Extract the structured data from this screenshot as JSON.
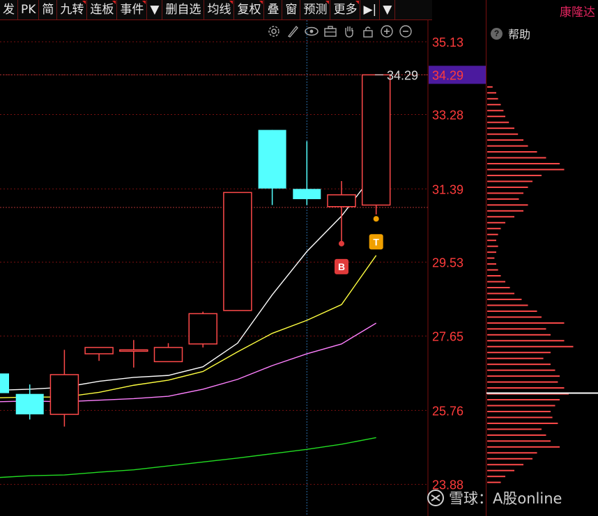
{
  "toolbar": {
    "items": [
      {
        "label": "发",
        "dot": false
      },
      {
        "label": "PK",
        "dot": false
      },
      {
        "label": "简",
        "dot": false
      },
      {
        "label": "九转",
        "dot": true
      },
      {
        "label": "连板",
        "dot": true
      },
      {
        "label": "事件",
        "dot": true
      },
      {
        "label": "▼",
        "dot": false
      },
      {
        "label": "删自选",
        "dot": false
      },
      {
        "label": "均线",
        "dot": true
      },
      {
        "label": "复权",
        "dot": true
      },
      {
        "label": "叠",
        "dot": false
      },
      {
        "label": "窗",
        "dot": false
      },
      {
        "label": "预测",
        "dot": true
      },
      {
        "label": "更多",
        "dot": true
      },
      {
        "label": "▶|",
        "dot": false
      },
      {
        "label": "▼",
        "dot": false
      }
    ]
  },
  "stock_name": "康隆达",
  "help": {
    "icon": "question-icon",
    "label": "帮助"
  },
  "chart_icons": [
    "gear-icon",
    "pen-icon",
    "eye-icon",
    "briefcase-icon",
    "hand-icon",
    "lock-icon",
    "zoom-in-icon",
    "zoom-out-icon"
  ],
  "watermark": "雪球：A股online",
  "colors": {
    "up": "#ff4a4a",
    "down": "#54ffff",
    "ma_white": "#ffffff",
    "ma_yellow": "#ffff40",
    "ma_pink": "#ff80ff",
    "ma_green": "#22dd22",
    "price_box": "#4b1a9e",
    "price_text": "#ff3b3b",
    "marker_b": "#e03a3a",
    "marker_t": "#f0a000"
  },
  "chart_data": {
    "type": "candlestick",
    "y_axis": {
      "ticks": [
        35.13,
        34.29,
        33.28,
        31.39,
        29.53,
        27.65,
        25.76,
        23.88
      ],
      "range": [
        23.58,
        35.86
      ]
    },
    "current_price": 34.29,
    "current_price_label": "34.29",
    "reference_line": 30.92,
    "grid": true,
    "candles": [
      {
        "open": 26.7,
        "high": 26.7,
        "low": 26.2,
        "close": 26.2
      },
      {
        "open": 26.18,
        "high": 26.42,
        "low": 25.53,
        "close": 25.66
      },
      {
        "open": 25.66,
        "high": 27.3,
        "low": 25.35,
        "close": 26.67
      },
      {
        "open": 27.2,
        "high": 27.36,
        "low": 27.02,
        "close": 27.36
      },
      {
        "open": 27.3,
        "high": 27.55,
        "low": 26.85,
        "close": 27.3
      },
      {
        "open": 27.0,
        "high": 27.47,
        "low": 27.0,
        "close": 27.36
      },
      {
        "open": 27.45,
        "high": 28.27,
        "low": 27.36,
        "close": 28.22
      },
      {
        "open": 28.3,
        "high": 31.3,
        "low": 28.3,
        "close": 31.3
      },
      {
        "open": 32.89,
        "high": 32.89,
        "low": 30.98,
        "close": 31.4
      },
      {
        "open": 31.39,
        "high": 32.6,
        "low": 30.98,
        "close": 31.13
      },
      {
        "open": 30.94,
        "high": 31.59,
        "low": 30.0,
        "close": 31.24
      },
      {
        "open": 30.98,
        "high": 34.29,
        "low": 30.74,
        "close": 34.29
      }
    ],
    "ma_white": [
      26.27,
      26.3,
      26.35,
      26.5,
      26.6,
      26.65,
      26.87,
      27.47,
      28.7,
      29.8,
      30.7,
      31.85
    ],
    "ma_yellow": [
      26.08,
      26.1,
      26.1,
      26.22,
      26.4,
      26.53,
      26.75,
      27.25,
      27.72,
      28.05,
      28.45,
      29.7
    ],
    "ma_pink": [
      25.98,
      26.0,
      25.98,
      26.02,
      26.06,
      26.12,
      26.3,
      26.55,
      26.9,
      27.2,
      27.45,
      27.98
    ],
    "ma_green": [
      24.05,
      24.1,
      24.12,
      24.19,
      24.25,
      24.35,
      24.45,
      24.55,
      24.66,
      24.77,
      24.9,
      25.07
    ],
    "signals": [
      {
        "label": "B",
        "index": 10,
        "value": 30.0
      },
      {
        "label": "T",
        "index": 11,
        "value": 30.63
      }
    ],
    "volume_profile": {
      "levels": [
        34.0,
        33.85,
        33.7,
        33.55,
        33.4,
        33.25,
        33.1,
        32.95,
        32.8,
        32.65,
        32.5,
        32.35,
        32.2,
        32.05,
        31.9,
        31.75,
        31.6,
        31.45,
        31.3,
        31.15,
        31.0,
        30.85,
        30.7,
        30.55,
        30.4,
        30.25,
        30.1,
        29.95,
        29.8,
        29.65,
        29.5,
        29.35,
        29.2,
        29.05,
        28.9,
        28.75,
        28.6,
        28.45,
        28.3,
        28.15,
        28.0,
        27.85,
        27.7,
        27.55,
        27.4,
        27.25,
        27.1,
        26.95,
        26.8,
        26.65,
        26.5,
        26.35,
        26.2,
        26.05,
        25.9,
        25.75,
        25.6,
        25.45,
        25.3,
        25.15,
        25.0,
        24.85,
        24.7,
        24.55,
        24.4,
        24.25,
        24.1,
        23.95
      ],
      "values": [
        0.06,
        0.1,
        0.12,
        0.15,
        0.18,
        0.2,
        0.24,
        0.3,
        0.34,
        0.4,
        0.45,
        0.55,
        0.65,
        0.8,
        0.85,
        0.6,
        0.5,
        0.45,
        0.4,
        0.35,
        0.45,
        0.4,
        0.3,
        0.2,
        0.15,
        0.12,
        0.1,
        0.12,
        0.1,
        0.08,
        0.1,
        0.12,
        0.15,
        0.2,
        0.25,
        0.3,
        0.38,
        0.45,
        0.55,
        0.6,
        0.85,
        0.65,
        0.7,
        0.85,
        0.95,
        0.7,
        0.62,
        0.7,
        0.75,
        0.8,
        0.78,
        0.85,
        0.9,
        0.8,
        0.75,
        0.7,
        0.72,
        0.78,
        0.6,
        0.65,
        0.7,
        0.8,
        0.55,
        0.5,
        0.4,
        0.3,
        0.2,
        0.15
      ],
      "current_level": 26.2
    }
  }
}
